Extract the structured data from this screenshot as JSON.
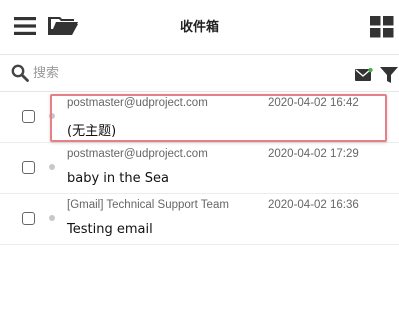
{
  "header": {
    "title": "收件箱",
    "icons": [
      "menu-icon",
      "folder-open-icon",
      "grid-view-icon"
    ]
  },
  "search": {
    "placeholder": "搜索",
    "icons": [
      "search-icon",
      "unread-mail-icon",
      "filter-icon"
    ]
  },
  "messages": [
    {
      "from": "postmaster@udproject.com",
      "time": "2020-04-02 16:42",
      "subject": "(无主题)",
      "selected": false,
      "highlighted": true
    },
    {
      "from": "postmaster@udproject.com",
      "time": "2020-04-02 17:29",
      "subject": "baby in the Sea",
      "selected": false,
      "highlighted": false
    },
    {
      "from": "[Gmail] Technical Support Team",
      "time": "2020-04-02 16:36",
      "subject": "Testing email",
      "selected": false,
      "highlighted": false
    }
  ],
  "colors": {
    "highlight_border": "#e77f86",
    "unread_dot": "#c8c8c8",
    "icon": "#333333",
    "notification_dot": "#4caf50"
  }
}
